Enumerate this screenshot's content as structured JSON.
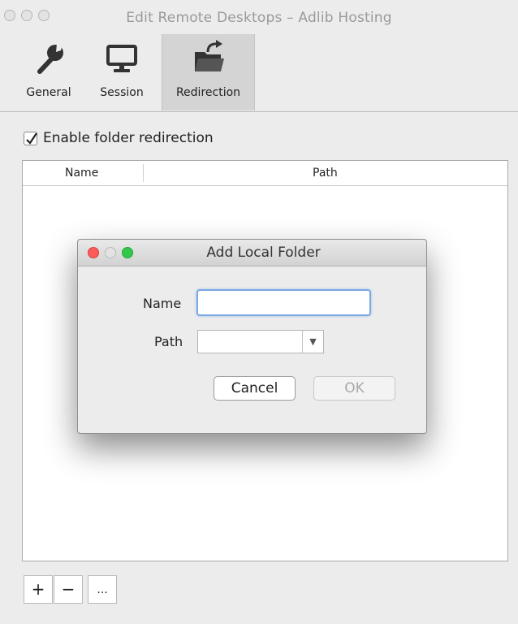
{
  "window": {
    "title": "Edit Remote Desktops – Adlib Hosting"
  },
  "toolbar": {
    "tabs": [
      {
        "label": "General",
        "icon": "wrench-icon"
      },
      {
        "label": "Session",
        "icon": "monitor-icon"
      },
      {
        "label": "Redirection",
        "icon": "folder-redirect-icon",
        "active": true
      }
    ]
  },
  "redirection": {
    "enable_label": "Enable folder redirection",
    "enabled": true,
    "table": {
      "columns": [
        "Name",
        "Path"
      ],
      "rows": []
    },
    "buttons": {
      "add": "+",
      "remove": "−",
      "more": "..."
    }
  },
  "dialog": {
    "title": "Add Local Folder",
    "name_label": "Name",
    "name_value": "",
    "path_label": "Path",
    "path_value": "",
    "cancel": "Cancel",
    "ok": "OK"
  },
  "colors": {
    "close": "#fc5b57",
    "minimize": "#e5e5e5",
    "zoom": "#34c84a",
    "focus_ring": "#7aa7e0"
  }
}
